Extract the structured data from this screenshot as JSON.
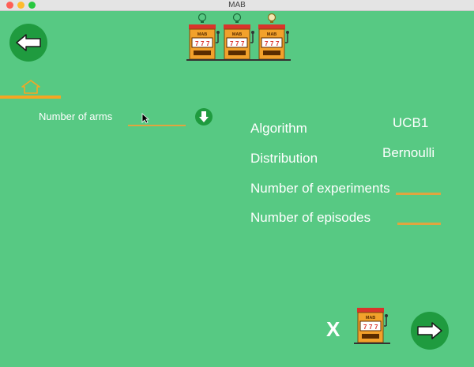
{
  "window": {
    "title": "MAB"
  },
  "header": {
    "logo_text": "MAB",
    "machine_count": 3
  },
  "form": {
    "arms_label": "Number of arms",
    "arms_value": "",
    "arms_placeholder": ""
  },
  "params": {
    "algorithm_label": "Algorithm",
    "algorithm_value": "UCB1",
    "distribution_label": "Distribution",
    "distribution_value": "Bernoulli",
    "experiments_label": "Number of experiments",
    "experiments_value": "",
    "episodes_label": "Number of episodes",
    "episodes_value": ""
  },
  "footer": {
    "multiplier_text": "X",
    "machine_label": "MAB"
  },
  "colors": {
    "background": "#57c983",
    "button": "#1f9b3f",
    "accent": "#f5a623",
    "machine_red": "#d9342b",
    "machine_orange": "#f2a12b"
  },
  "icons": {
    "back": "arrow-left-icon",
    "next": "arrow-right-icon",
    "home": "home-icon",
    "download": "arrow-down-icon"
  }
}
